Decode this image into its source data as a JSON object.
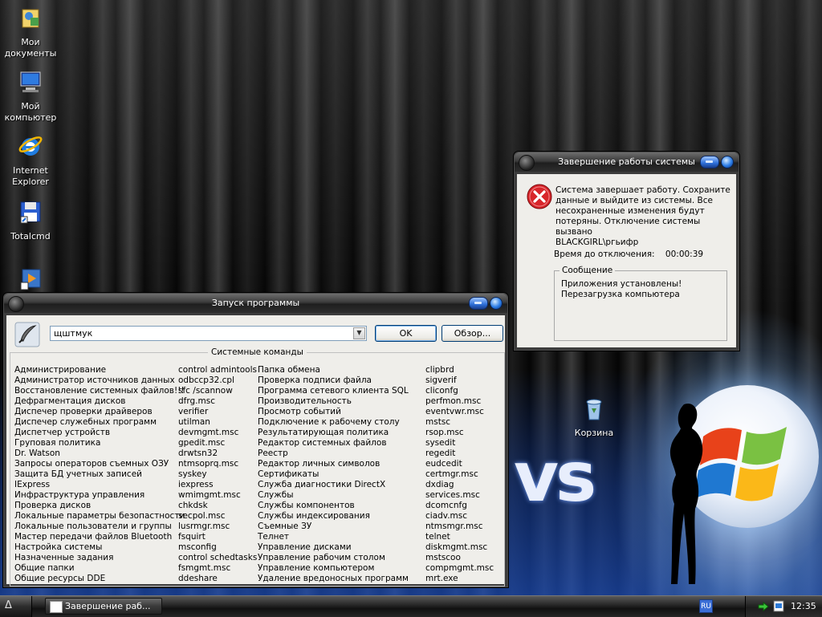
{
  "desktop": {
    "icons": [
      {
        "line1": "Мои",
        "line2": "документы"
      },
      {
        "line1": "Мой",
        "line2": "компьютер"
      },
      {
        "line1": "Internet",
        "line2": "Explorer"
      },
      {
        "line1": "Totalcmd",
        "line2": ""
      }
    ],
    "recycle_bin": "Корзина"
  },
  "shutdown_dialog": {
    "title": "Завершение работы системы",
    "message_lines": [
      "Система завершает работу.  Сохраните",
      "данные и выйдите из системы.  Все",
      "несохраненные изменения будут",
      "потеряны.  Отключение системы вызвано",
      "BLACKGIRL\\ргьифр"
    ],
    "time_label": "Время до отключения:",
    "time_value": "00:00:39",
    "group_label": "Сообщение",
    "group_lines": [
      "Приложения установлены!",
      "Перезагрузка компьютера"
    ]
  },
  "run_dialog": {
    "title": "Запуск программы",
    "input_value": "щштмук",
    "ok_label": "OK",
    "browse_label": "Обзор...",
    "group_label": "Системные команды",
    "columns": [
      [
        "Администрирование",
        "Администратор источников данных",
        "Восстановление системных файлов!!!",
        "Дефрагментация дисков",
        "Диспечер проверки драйверов",
        "Диспечер служебных программ",
        "Диспетчер устройств",
        "Груповая политика",
        "Dr. Watson",
        "Запросы операторов съемных ОЗУ",
        "Защита БД учетных записей",
        "IExpress",
        "Инфраструктура управления",
        "Проверка дисков",
        "Локальные параметры безопастности",
        "Локальные пользователи и группы",
        "Мастер передачи файлов Bluetooth",
        "Настройка системы",
        "Назначенные задания",
        "Общие папки",
        "Общие ресурсы DDE"
      ],
      [
        "control admintools",
        "odbccp32.cpl",
        "sfc /scannow",
        "dfrg.msc",
        "verifier",
        "utilman",
        "devmgmt.msc",
        "gpedit.msc",
        "drwtsn32",
        "ntmsoprq.msc",
        "syskey",
        "iexpress",
        "wmimgmt.msc",
        "chkdsk",
        "secpol.msc",
        "lusrmgr.msc",
        "fsquirt",
        "msconfig",
        "control schedtasks",
        "fsmgmt.msc",
        "ddeshare"
      ],
      [
        "Папка обмена",
        "Проверка подписи файла",
        "Программа сетевого клиента SQL",
        "Производительность",
        "Просмотр событий",
        "Подключение к рабочему столу",
        "Результатирующая политика",
        "Редактор системных файлов",
        "Реестр",
        "Редактор личных символов",
        "Сертификаты",
        "Служба диагностики DirectX",
        "Службы",
        "Службы компонентов",
        "Службы индексирования",
        "Съемные ЗУ",
        "Телнет",
        "Управление дисками",
        "Управление рабочим столом",
        "Управление компьютером",
        "Удаление вредоносных программ"
      ],
      [
        "clipbrd",
        "sigverif",
        "cliconfg",
        "perfmon.msc",
        "eventvwr.msc",
        "mstsc",
        "rsop.msc",
        "sysedit",
        "regedit",
        "eudcedit",
        "certmgr.msc",
        "dxdiag",
        "services.msc",
        "dcomcnfg",
        "ciadv.msc",
        "ntmsmgr.msc",
        "telnet",
        "diskmgmt.msc",
        "mstscoo",
        "compmgmt.msc",
        "mrt.exe"
      ]
    ]
  },
  "taskbar": {
    "start_glyph": "Δ",
    "task_label": "Завершение раб...",
    "lang": "RU",
    "clock": "12:35"
  },
  "background_text": "vs"
}
